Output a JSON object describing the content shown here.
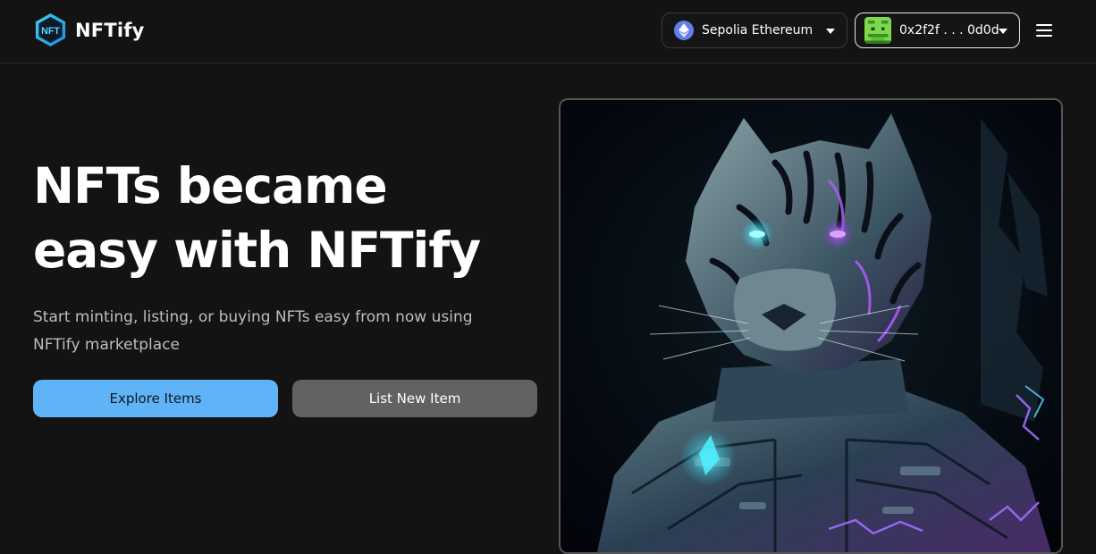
{
  "header": {
    "logo": {
      "badge_text": "NFT",
      "app_name": "NFTify"
    },
    "network_selector": {
      "label": "Sepolia Ethereum",
      "icon": "ethereum-icon",
      "color": "#627eea"
    },
    "account_selector": {
      "address": "0x2f2f . . . 0d0d",
      "avatar_icon": "pixel-avatar-icon"
    },
    "menu_icon": "hamburger-menu-icon"
  },
  "hero": {
    "title_line1": "NFTs became",
    "title_line2": "easy with NFTify",
    "subtitle_line1": "Start minting, listing, or buying NFTs easy from now using",
    "subtitle_line2": "NFTify marketplace",
    "primary_button": "Explore Items",
    "secondary_button": "List New Item"
  },
  "artwork": {
    "subject": "cyber tiger illustration"
  },
  "colors": {
    "background": "#131313",
    "accent": "#5fb3f6",
    "secondary_button": "#626262",
    "border": "#3a3a3a"
  }
}
